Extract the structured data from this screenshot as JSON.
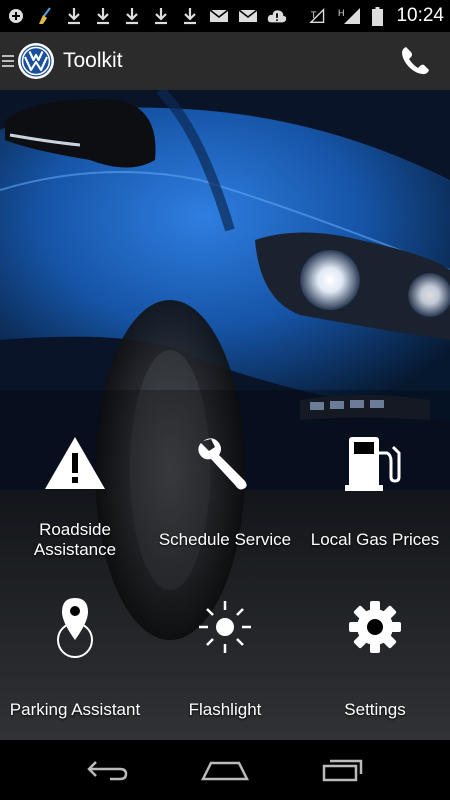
{
  "status_bar": {
    "time": "10:24",
    "icons": [
      "add-icon",
      "broom-icon",
      "download-icon",
      "download-icon",
      "download-icon",
      "download-icon",
      "download-icon",
      "mail-icon",
      "mail-icon",
      "alert-icon",
      "signal-off-icon",
      "h-signal-icon",
      "battery-icon"
    ],
    "network_label": "H"
  },
  "action_bar": {
    "title": "Toolkit",
    "logo_text": "VW"
  },
  "tiles": [
    {
      "id": "roadside",
      "label": "Roadside Assistance",
      "icon": "warning-icon"
    },
    {
      "id": "schedule",
      "label": "Schedule Service",
      "icon": "wrench-icon"
    },
    {
      "id": "gas",
      "label": "Local Gas Prices",
      "icon": "gas-pump-icon"
    },
    {
      "id": "parking",
      "label": "Parking Assistant",
      "icon": "location-pin-icon"
    },
    {
      "id": "flashlight",
      "label": "Flashlight",
      "icon": "sun-icon"
    },
    {
      "id": "settings",
      "label": "Settings",
      "icon": "gear-icon"
    }
  ],
  "colors": {
    "action_bar": "#2b2b2b",
    "car_blue": "#1a5bb0",
    "status_bar": "#000000"
  }
}
